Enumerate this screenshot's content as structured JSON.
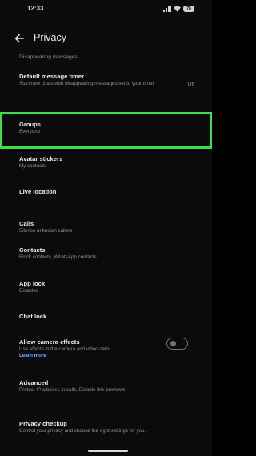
{
  "status_bar": {
    "time": "12:33",
    "battery": "78"
  },
  "header": {
    "title": "Privacy"
  },
  "section_label": "Disappearing messages",
  "items": [
    {
      "title": "Default message timer",
      "subtitle": "Start new chats with disappearing messages set to your timer",
      "value": "Off"
    },
    {
      "title": "Groups",
      "subtitle": "Everyone"
    },
    {
      "title": "Avatar stickers",
      "subtitle": "My contacts"
    },
    {
      "title": "Live location",
      "subtitle": ""
    },
    {
      "title": "Calls",
      "subtitle": "Silence unknown callers"
    },
    {
      "title": "Contacts",
      "subtitle": "Block contacts, WhatsApp contacts"
    },
    {
      "title": "App lock",
      "subtitle": "Disabled"
    },
    {
      "title": "Chat lock",
      "subtitle": ""
    },
    {
      "title": "Allow camera effects",
      "subtitle": "Use effects in the camera and video calls.",
      "link": "Learn more",
      "toggle_on": false
    },
    {
      "title": "Advanced",
      "subtitle": "Protect IP address in calls, Disable link previews"
    },
    {
      "title": "Privacy checkup",
      "subtitle": "Control your privacy and choose the right settings for you."
    }
  ],
  "colors": {
    "highlight": "#39e049",
    "background": "#0b0b0b",
    "link": "#6cb4ff"
  },
  "icons": {
    "back": "back-arrow-icon",
    "signal": "signal-icon",
    "wifi": "wifi-icon",
    "battery": "battery-icon"
  }
}
